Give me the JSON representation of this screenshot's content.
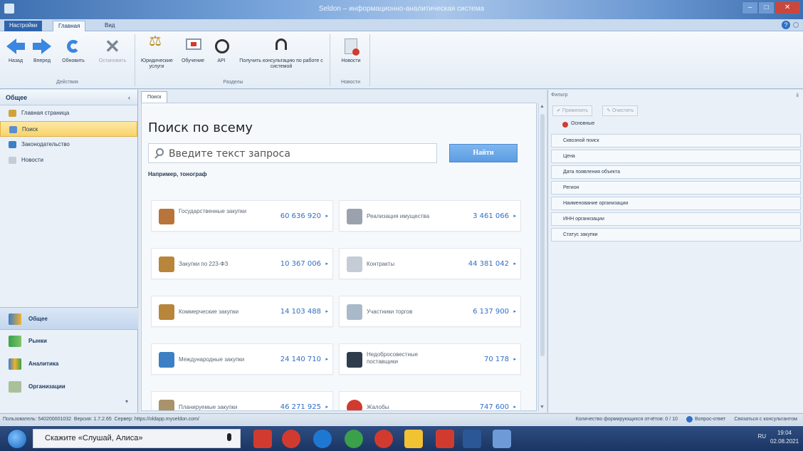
{
  "window": {
    "title": "Seldon – информационно-аналитическая система"
  },
  "ribbon_tabs": [
    "Настройки",
    "Главная",
    "Вид"
  ],
  "ribbon": {
    "groups": [
      {
        "title": "Действия",
        "buttons": [
          "Назад",
          "Вперед",
          "Обновить",
          "Остановить"
        ]
      },
      {
        "title": "Разделы",
        "buttons": [
          "Юридические услуги",
          "Обучение",
          "API",
          "Получить консультацию по работе с системой"
        ]
      },
      {
        "title": "Новости",
        "buttons": [
          "Новости"
        ]
      }
    ]
  },
  "sidebar": {
    "header": "Общее",
    "collapse": "‹",
    "items": [
      "Главная страница",
      "Поиск",
      "Законодательство",
      "Новости"
    ],
    "nav": [
      "Общее",
      "Рынки",
      "Аналитика",
      "Организации"
    ],
    "more": "▾"
  },
  "main": {
    "doc_tab": "Поиск",
    "title": "Поиск по всему",
    "search_placeholder": "Введите текст запроса",
    "find_button": "Найти",
    "example": "Например, тонограф",
    "cards": [
      {
        "label": "Государственные закупки",
        "value": "60 636 920",
        "icon": "gov-procurement-icon",
        "color": "#b8743a"
      },
      {
        "label": "Реализация имущества",
        "value": "3 461 066",
        "icon": "property-sale-icon",
        "color": "#9aa3ad"
      },
      {
        "label": "Закупки по 223-ФЗ",
        "value": "10 367 006",
        "icon": "procurement-223-icon",
        "color": "#b8863a"
      },
      {
        "label": "Контракты",
        "value": "44 381 042",
        "icon": "contracts-icon",
        "color": "#c4ccd6"
      },
      {
        "label": "Коммерческие закупки",
        "value": "14 103 488",
        "icon": "commercial-procurement-icon",
        "color": "#b8863a"
      },
      {
        "label": "Участники торгов",
        "value": "6 137 900",
        "icon": "bidders-icon",
        "color": "#a9b9c9"
      },
      {
        "label": "Международные закупки",
        "value": "24 140 710",
        "icon": "international-procurement-icon",
        "color": "#3d7fc4"
      },
      {
        "label": "Недобросовестные поставщики",
        "value": "70 178",
        "icon": "unfair-suppliers-icon",
        "color": "#2f3c4c"
      },
      {
        "label": "Планируемые закупки",
        "value": "46 271 925",
        "icon": "planned-procurement-icon",
        "color": "#a9936a"
      },
      {
        "label": "Жалобы",
        "value": "747 600",
        "icon": "complaints-icon",
        "color": "#d13b2f"
      }
    ],
    "card_arrow": "▸"
  },
  "filter": {
    "header": "Фильтр",
    "pin": "ⅱ",
    "apply": "Применить",
    "clear": "Очистить",
    "basic": "Основные",
    "rows": [
      "Сквозной поиск",
      "Цена",
      "Дата появления объекта",
      "Регион",
      "Наименование организации",
      "ИНН организации",
      "Статус закупки"
    ]
  },
  "status": {
    "user": "Пользователь: 540200001032",
    "version": "Версия: 1.7.2.65",
    "server": "Сервер: https://oldapp.myseldon.com/",
    "reports": "Количество формирующихся отчётов: 0 / 10",
    "qa": "Вопрос-ответ",
    "consult": "Связаться с консультантом"
  },
  "taskbar": {
    "search_text": "Скажите «Слушай, Алиса»",
    "lang": "RU",
    "time": "19:04",
    "date": "02.08.2021"
  }
}
